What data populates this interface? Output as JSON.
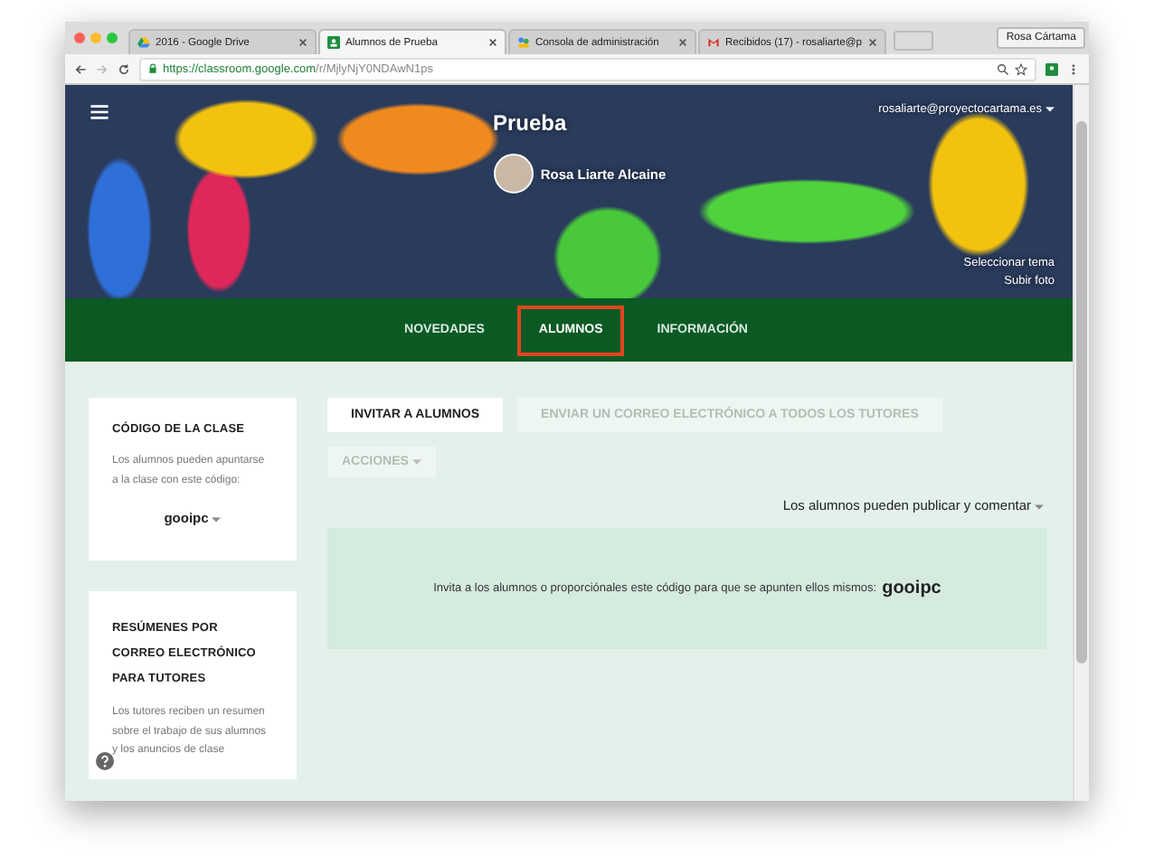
{
  "browser": {
    "tabs": [
      {
        "title": "2016 - Google Drive",
        "kind": "triangle",
        "selected": false
      },
      {
        "title": "Alumnos de Prueba",
        "kind": "board",
        "selected": true
      },
      {
        "title": "Consola de administración",
        "kind": "people",
        "selected": false
      },
      {
        "title": "Recibidos (17) - rosaliarte@p",
        "kind": "envelope",
        "selected": false
      }
    ],
    "profile": "Rosa Cártama",
    "url_host": "https://classroom.google.com",
    "url_path": "/r/MjlyNjY0NDAwN1ps"
  },
  "header": {
    "class_name": "Prueba",
    "account": "rosaliarte@proyectocartama.es",
    "teacher": "Rosa Liarte Alcaine",
    "links": [
      "Seleccionar tema",
      "Subir foto"
    ]
  },
  "nav": [
    {
      "label": "NOVEDADES",
      "selected": false
    },
    {
      "label": "ALUMNOS",
      "selected": true
    },
    {
      "label": "INFORMACIÓN",
      "selected": false
    }
  ],
  "class_code_card": {
    "title": "CÓDIGO DE LA CLASE",
    "text": "Los alumnos pueden apuntarse a la clase con este código:",
    "code": "gooipc"
  },
  "summary_card": {
    "title": "RESÚMENES POR CORREO ELECTRÓNICO PARA TUTORES",
    "text": "Los tutores reciben un resumen sobre el trabajo de sus alumnos y los anuncios de clase"
  },
  "actions": [
    {
      "label": "INVITAR A ALUMNOS",
      "disabled": false
    },
    {
      "label": "ENVIAR UN CORREO ELECTRÓNICO A TODOS LOS TUTORES",
      "disabled": true
    }
  ],
  "menu": {
    "label": "ACCIONES",
    "disabled": true
  },
  "permission": "Los alumnos pueden publicar y comentar",
  "invite": {
    "text": "Invita a los alumnos o proporciónales este código para que se apunten ellos mismos:",
    "code": "gooipc"
  }
}
